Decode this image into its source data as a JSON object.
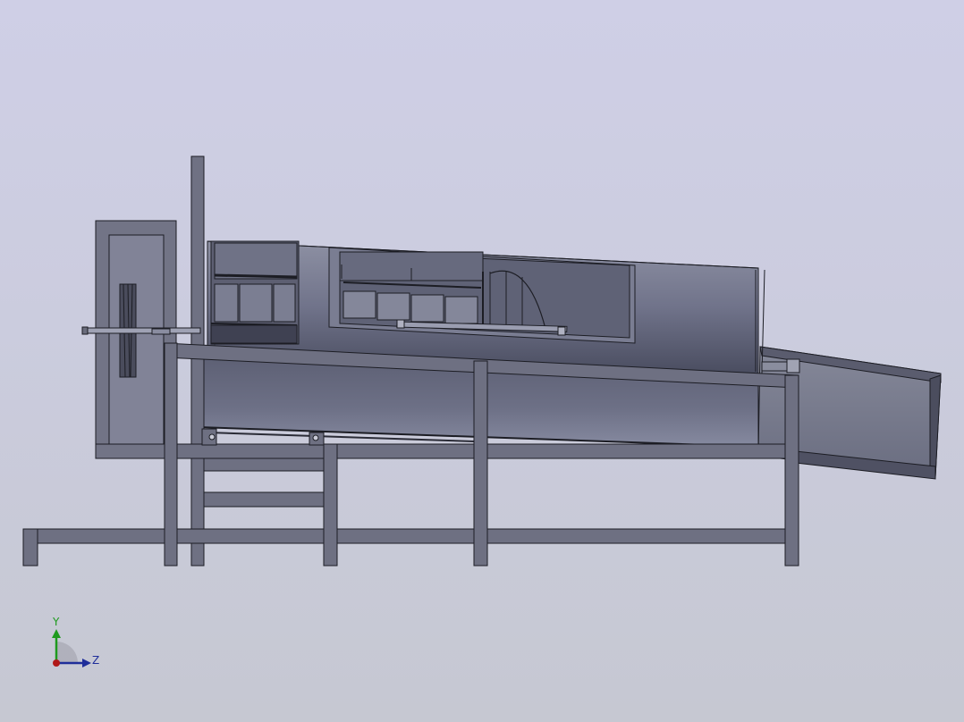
{
  "viewport": {
    "background_top": "#cfcfe6",
    "background_bottom": "#c6c8d2"
  },
  "model": {
    "name": "drum-screen-machine",
    "frame_color": "#6e7080",
    "drum_color": "#7a7d8e",
    "edge_color": "#1c1d24"
  },
  "triad": {
    "y_label": "Y",
    "z_label": "Z",
    "y_color": "#1e9a1e",
    "z_color": "#1f2e9a",
    "x_color": "#b01818"
  }
}
